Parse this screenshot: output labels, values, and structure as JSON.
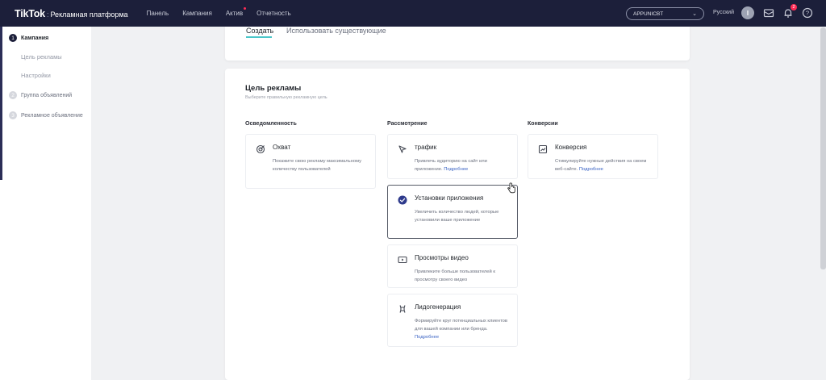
{
  "header": {
    "logo_main": "TikTok",
    "logo_sep": ":",
    "logo_sub": "Рекламная платформа",
    "nav": [
      "Панель",
      "Кампания",
      "Актив",
      "Отчетность"
    ],
    "account": "APPUNICBT",
    "language": "Русский",
    "avatar_letter": "I",
    "notification_count": "2",
    "help_icon": "help-icon",
    "mail_icon": "mail-icon",
    "bell_icon": "bell-icon"
  },
  "sidebar": {
    "steps": [
      {
        "number": "1",
        "label": "Кампания"
      },
      {
        "number": "2",
        "label": "Группа объявлений"
      },
      {
        "number": "3",
        "label": "Рекламное объявление"
      }
    ],
    "substeps": [
      "Цель рекламы",
      "Настройки"
    ]
  },
  "tabs": {
    "create": "Создать",
    "use_existing": "Использовать существующие"
  },
  "goal": {
    "title": "Цель рекламы",
    "subtitle": "Выберите правильную рекламную цель",
    "columns": [
      "Осведомленность",
      "Рассмотрение",
      "Конверсии"
    ],
    "objectives": [
      {
        "title": "Охват",
        "desc": "Покажите свою рекламу максимальному количеству пользователей",
        "more": "",
        "icon": "reach-icon"
      },
      {
        "title": "трафик",
        "desc": "Привлечь аудиторию на сайт или приложение.",
        "more": "Подробнее",
        "icon": "cursor-arrow-icon"
      },
      {
        "title": "Установки приложения",
        "desc": "Увеличить количество людей, которые установили ваше приложение",
        "more": "",
        "icon": "check-circle-icon",
        "selected": true
      },
      {
        "title": "Просмотры видео",
        "desc": "Привлеките больше пользователей к просмотру своего видео",
        "more": "",
        "icon": "video-icon"
      },
      {
        "title": "Лидогенерация",
        "desc": "Формируйте круг потенциальных клиентов для вашей компании или бренда.",
        "more": "Подробнее",
        "icon": "lead-icon"
      },
      {
        "title": "Конверсия",
        "desc": "Стимулируйте нужные действия на своем веб-сайте.",
        "more": "Подробнее",
        "icon": "conversion-icon"
      }
    ]
  },
  "colors": {
    "topbar": "#1c1f3a",
    "accent": "#4bc6c9",
    "link": "#3a63c4",
    "badge": "#fe2c55"
  }
}
